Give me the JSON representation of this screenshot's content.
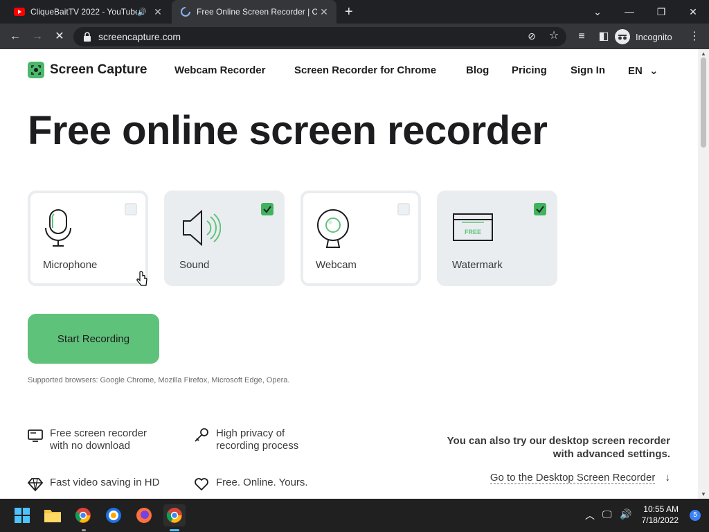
{
  "browser": {
    "tabs": [
      {
        "title": "CliqueBaitTV 2022 - YouTube",
        "favicon": "youtube-icon",
        "audio": true
      },
      {
        "title": "Free Online Screen Recorder | Onl",
        "favicon": "loading-spinner-icon",
        "active": true
      }
    ],
    "url": "screencapture.com",
    "incognito_label": "Incognito"
  },
  "site": {
    "brand": "Screen Capture",
    "brand_color": "#4bb96b",
    "nav": [
      "Webcam Recorder",
      "Screen Recorder for Chrome",
      "Blog",
      "Pricing",
      "Sign In"
    ],
    "language": "EN",
    "headline": "Free online screen recorder",
    "options": [
      {
        "label": "Microphone",
        "checked": false,
        "icon": "microphone-icon"
      },
      {
        "label": "Sound",
        "checked": true,
        "icon": "speaker-icon"
      },
      {
        "label": "Webcam",
        "checked": false,
        "icon": "webcam-icon"
      },
      {
        "label": "Watermark",
        "checked": true,
        "icon": "watermark-icon",
        "badge": "FREE"
      }
    ],
    "start_button": "Start Recording",
    "supported": "Supported browsers: Google Chrome, Mozilla Firefox, Microsoft Edge, Opera.",
    "features": [
      {
        "text": "Free screen recorder\nwith no download",
        "icon": "monitor-icon"
      },
      {
        "text": "High privacy of\nrecording process",
        "icon": "key-icon"
      },
      {
        "text": "Fast video saving in HD",
        "icon": "diamond-icon"
      },
      {
        "text": "Free. Online. Yours.",
        "icon": "heart-icon"
      }
    ],
    "desktop_promo_line1": "You can also try our desktop screen recorder",
    "desktop_promo_line2": "with advanced settings.",
    "desktop_link": "Go to the Desktop Screen Recorder"
  },
  "taskbar": {
    "time": "10:55 AM",
    "date": "7/18/2022",
    "notifications": "5"
  }
}
